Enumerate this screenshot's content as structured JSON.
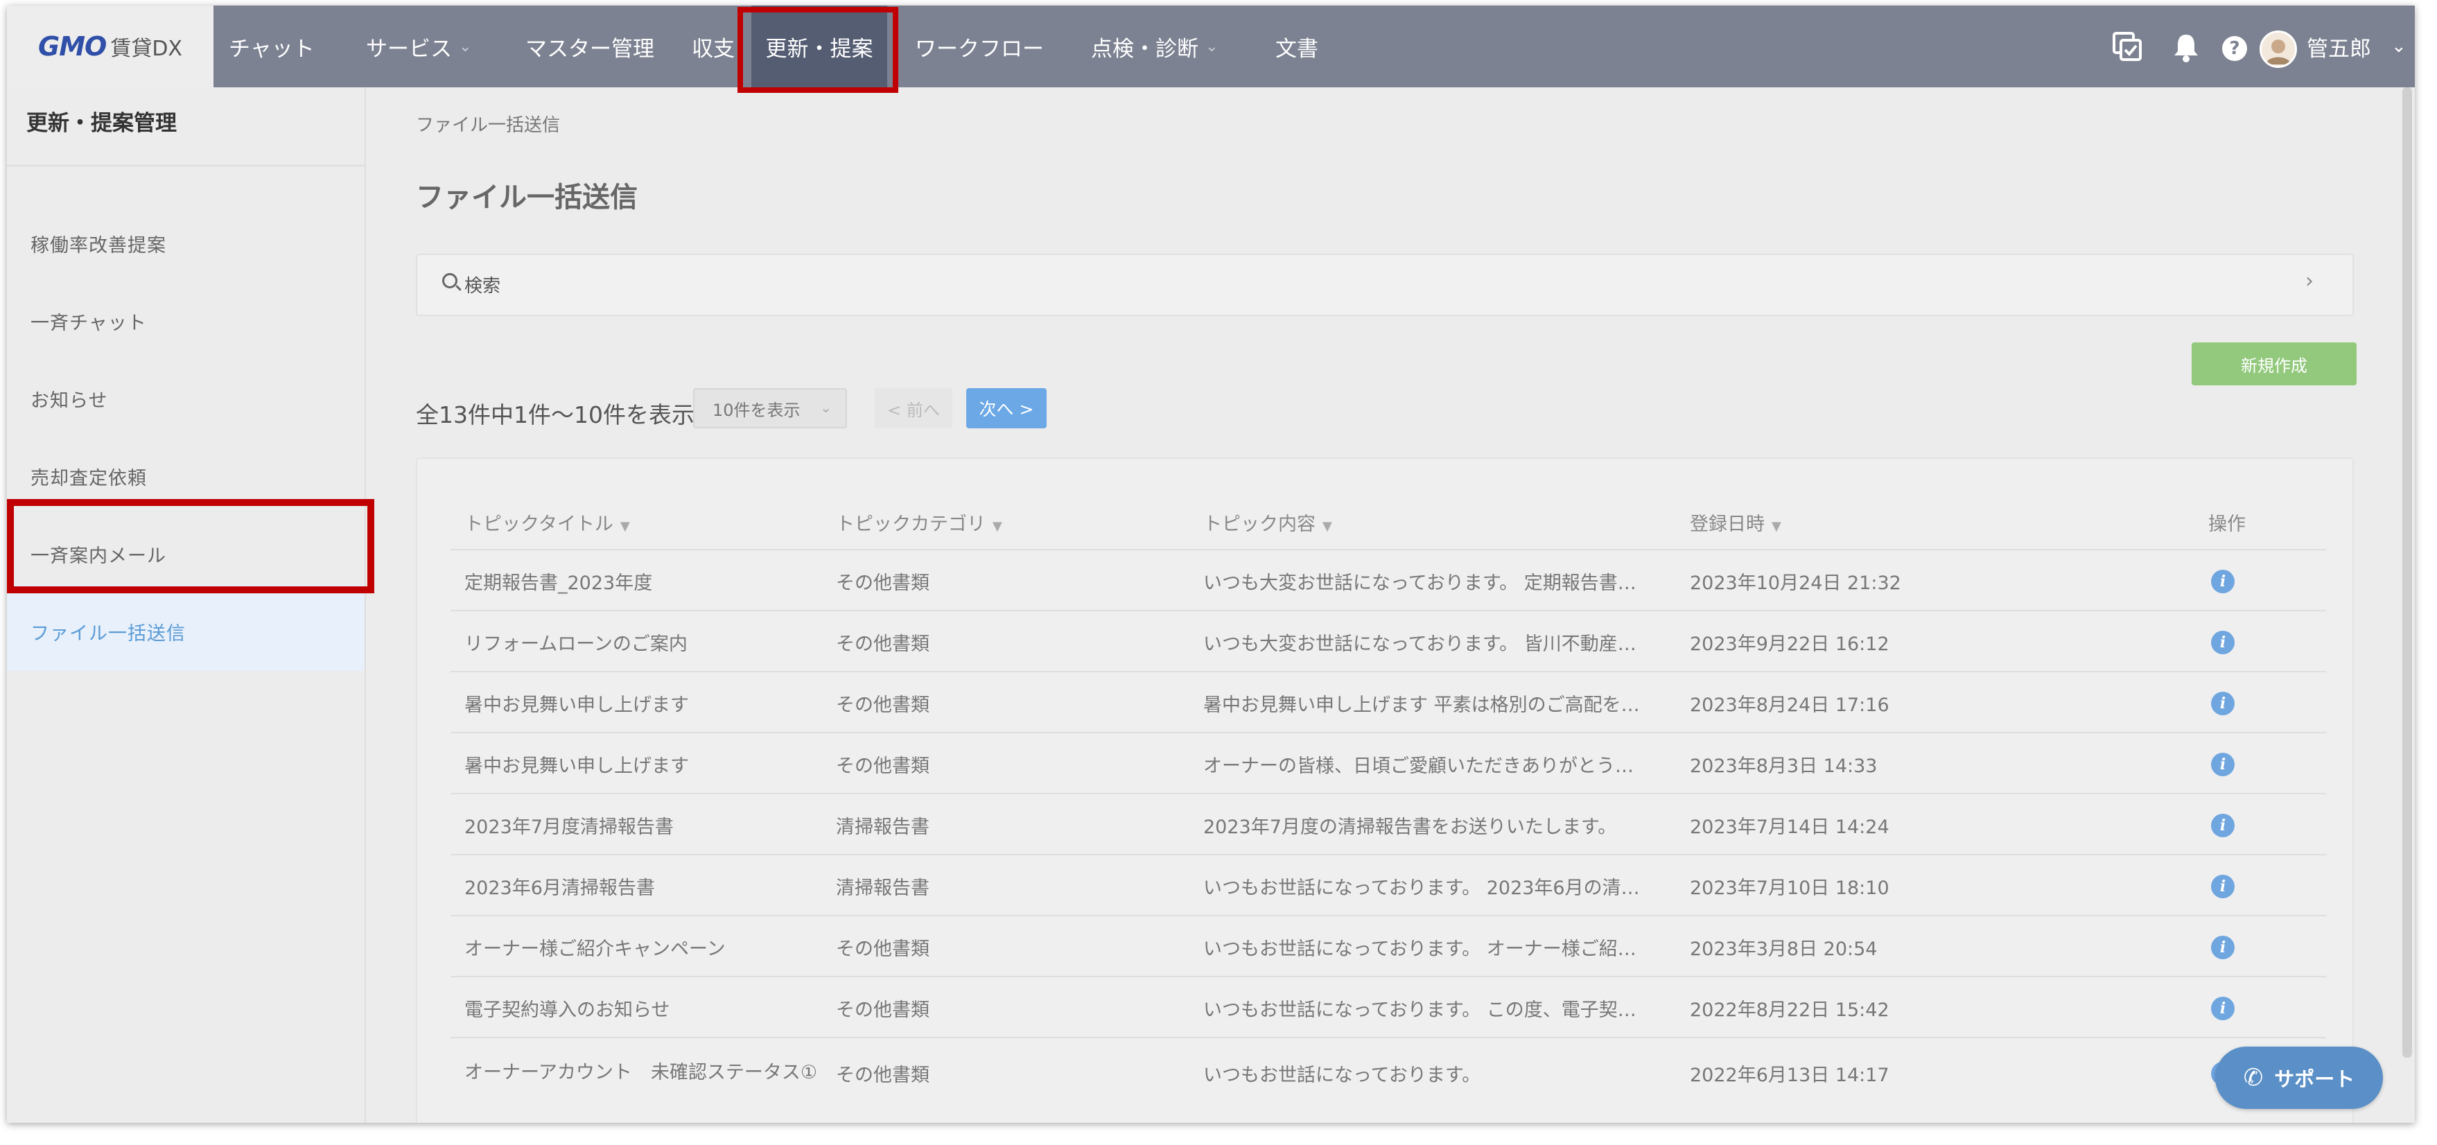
{
  "app": {
    "logo_brand": "GMO",
    "logo_product": "賃貸DX"
  },
  "nav": {
    "items": [
      {
        "label": "チャット",
        "has_dropdown": false
      },
      {
        "label": "サービス",
        "has_dropdown": true
      },
      {
        "label": "マスター管理",
        "has_dropdown": false
      },
      {
        "label": "収支",
        "has_dropdown": false
      },
      {
        "label": "更新・提案",
        "has_dropdown": false,
        "active": true
      },
      {
        "label": "ワークフロー",
        "has_dropdown": false
      },
      {
        "label": "点検・診断",
        "has_dropdown": true
      },
      {
        "label": "文書",
        "has_dropdown": false
      }
    ],
    "user_name": "管五郎",
    "icons": [
      "task-check-icon",
      "bell-icon",
      "help-icon",
      "avatar"
    ]
  },
  "sidebar": {
    "title": "更新・提案管理",
    "items": [
      {
        "label": "稼働率改善提案"
      },
      {
        "label": "一斉チャット"
      },
      {
        "label": "お知らせ"
      },
      {
        "label": "売却査定依頼"
      },
      {
        "label": "一斉案内メール"
      },
      {
        "label": "ファイル一括送信",
        "active": true
      }
    ]
  },
  "main": {
    "breadcrumb": "ファイル一括送信",
    "page_title": "ファイル一括送信",
    "search_label": "検索",
    "new_button": "新規作成",
    "count_text": "全13件中1件〜10件を表示",
    "per_page": "10件を表示",
    "prev_label": "< 前へ",
    "next_label": "次へ >",
    "table": {
      "headers": [
        "トピックタイトル",
        "トピックカテゴリ",
        "トピック内容",
        "登録日時",
        "操作"
      ],
      "rows": [
        {
          "title": "定期報告書_2023年度",
          "category": "その他書類",
          "content": "いつも大変お世話になっております。 定期報告書…",
          "date": "2023年10月24日 21:32"
        },
        {
          "title": "リフォームローンのご案内",
          "category": "その他書類",
          "content": "いつも大変お世話になっております。 皆川不動産…",
          "date": "2023年9月22日 16:12"
        },
        {
          "title": "暑中お見舞い申し上げます",
          "category": "その他書類",
          "content": "暑中お見舞い申し上げます 平素は格別のご高配を…",
          "date": "2023年8月24日 17:16"
        },
        {
          "title": "暑中お見舞い申し上げます",
          "category": "その他書類",
          "content": "オーナーの皆様、日頃ご愛顧いただきありがとう…",
          "date": "2023年8月3日 14:33"
        },
        {
          "title": "2023年7月度清掃報告書",
          "category": "清掃報告書",
          "content": "2023年7月度の清掃報告書をお送りいたします。",
          "date": "2023年7月14日 14:24"
        },
        {
          "title": "2023年6月清掃報告書",
          "category": "清掃報告書",
          "content": "いつもお世話になっております。 2023年6月の清…",
          "date": "2023年7月10日 18:10"
        },
        {
          "title": "オーナー様ご紹介キャンペーン",
          "category": "その他書類",
          "content": "いつもお世話になっております。 オーナー様ご紹…",
          "date": "2023年3月8日 20:54"
        },
        {
          "title": "電子契約導入のお知らせ",
          "category": "その他書類",
          "content": "いつもお世話になっております。 この度、電子契…",
          "date": "2022年8月22日 15:42"
        },
        {
          "title": "オーナーアカウント　未確認ステータス①",
          "category": "その他書類",
          "content": "いつもお世話になっております。",
          "date": "2022年6月13日 14:17"
        }
      ]
    }
  },
  "support_button": "サポート",
  "colors": {
    "nav_bg": "#7d8292",
    "nav_active": "#555d73",
    "highlight": "#c00000",
    "accent": "#5b9bd5",
    "new_button": "#92c97c"
  }
}
